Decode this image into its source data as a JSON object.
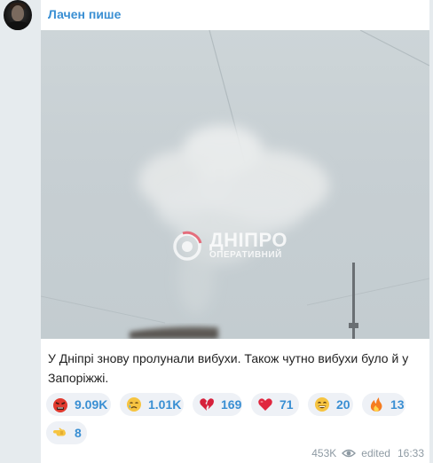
{
  "channel": {
    "name": "Лачен пише"
  },
  "photo": {
    "watermark_line1": "ДНІПРО",
    "watermark_line2": "ОПЕРАТИВНИЙ"
  },
  "message": {
    "caption": "У Дніпрі знову пролунали вибухи. Також чутно вибухи було й у Запоріжжі."
  },
  "reactions": [
    {
      "icon": "angry-face-icon",
      "count": "9.09K"
    },
    {
      "icon": "crying-face-icon",
      "count": "1.01K"
    },
    {
      "icon": "broken-heart-icon",
      "count": "169"
    },
    {
      "icon": "red-heart-icon",
      "count": "71"
    },
    {
      "icon": "grinning-face-icon",
      "count": "20"
    },
    {
      "icon": "fire-icon",
      "count": "13"
    },
    {
      "icon": "pointing-hand-icon",
      "count": "8"
    }
  ],
  "meta": {
    "views": "453K",
    "status": "edited",
    "time": "16:33"
  }
}
